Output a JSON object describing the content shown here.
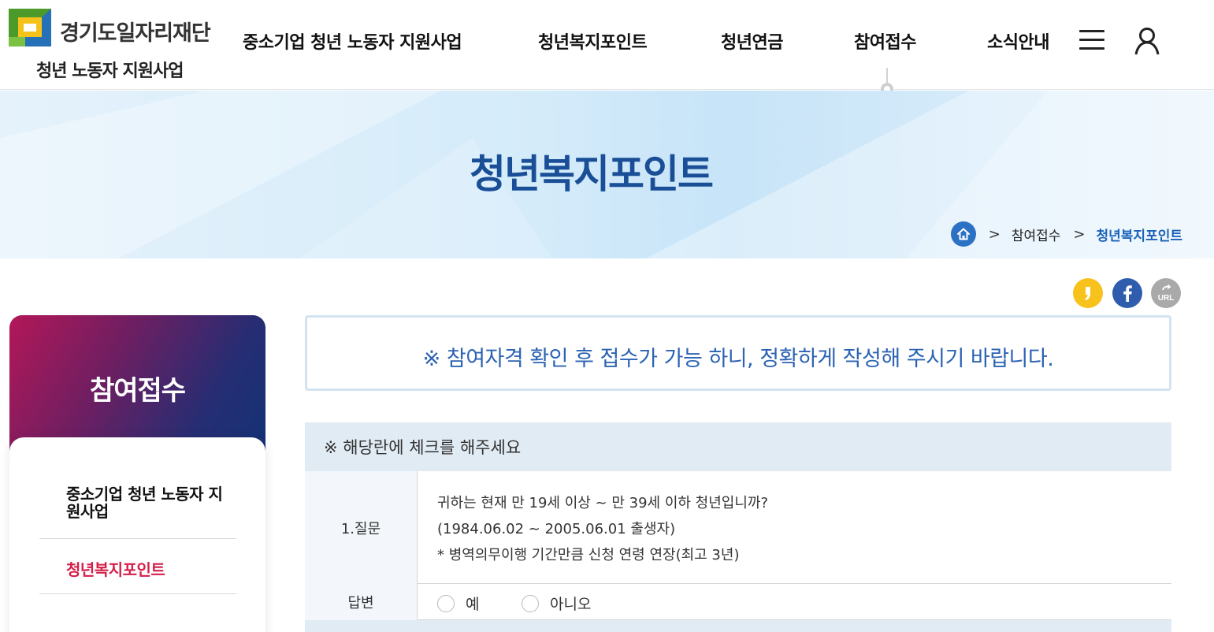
{
  "header": {
    "logo_title": "경기도일자리재단",
    "logo_subtitle": "청년 노동자 지원사업",
    "nav": [
      {
        "label": "중소기업 청년 노동자 지원사업"
      },
      {
        "label": "청년복지포인트"
      },
      {
        "label": "청년연금"
      },
      {
        "label": "참여접수"
      },
      {
        "label": "소식안내"
      }
    ],
    "active_nav": "참여접수",
    "icons": [
      "hamburger-menu-icon",
      "user-icon"
    ]
  },
  "banner": {
    "title": "청년복지포인트",
    "breadcrumb": {
      "home_icon": "home-icon",
      "items": [
        "참여접수",
        "청년복지포인트"
      ]
    }
  },
  "share": {
    "icons": [
      "kakaostory-icon",
      "facebook-icon",
      "url-copy-icon"
    ],
    "url_label": "URL"
  },
  "sidebar": {
    "title": "참여접수",
    "items": [
      {
        "label": "중소기업 청년 노동자 지원사업",
        "active": false
      },
      {
        "label": "청년복지포인트",
        "active": true
      }
    ]
  },
  "notice": {
    "text": "※ 참여자격 확인 후 접수가 가능 하니, 정확하게 작성해 주시기 바랍니다."
  },
  "form": {
    "header": "※ 해당란에 체크를 해주세요",
    "question": {
      "label": "1.질문",
      "lines": [
        "귀하는 현재 만 19세 이상 ~ 만 39세 이하 청년입니까?",
        "(1984.06.02 ~ 2005.06.01 출생자)",
        "* 병역의무이행 기간만큼 신청 연령 연장(최고 3년)"
      ]
    },
    "answer": {
      "label": "답변",
      "options": [
        "예",
        "아니오"
      ],
      "selected": null
    }
  },
  "colors": {
    "brand_blue": "#1a4f97",
    "accent_blue": "#2c63b3",
    "active_red": "#d4204b",
    "table_header_bg": "#e1ebf4",
    "kakao_yellow": "#f7c21b",
    "facebook_blue": "#2f5cad"
  }
}
